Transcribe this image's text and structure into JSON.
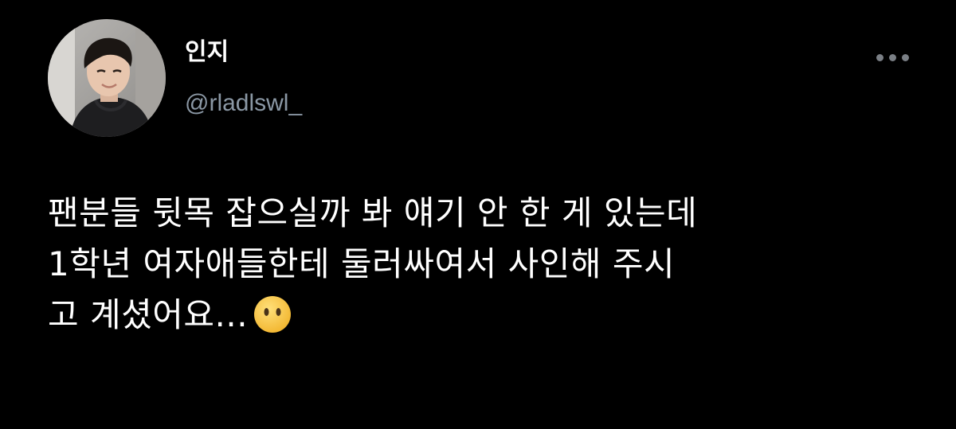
{
  "author": {
    "display_name": "인지",
    "handle": "@rladlswl_"
  },
  "more_icon": "more-horizontal-icon",
  "tweet": {
    "lines": [
      "팬분들 뒷목 잡으실까 봐 얘기 안 한 게 있는데",
      "1학년 여자애들한테 둘러싸여서 사인해 주시",
      "고 계셨어요..."
    ],
    "emoji": "face-without-mouth-emoji"
  },
  "colors": {
    "background": "#000000",
    "text": "#ffffff",
    "handle": "#8b98a5",
    "more_dots": "#7a7f85",
    "emoji_face": "#f7c948"
  }
}
